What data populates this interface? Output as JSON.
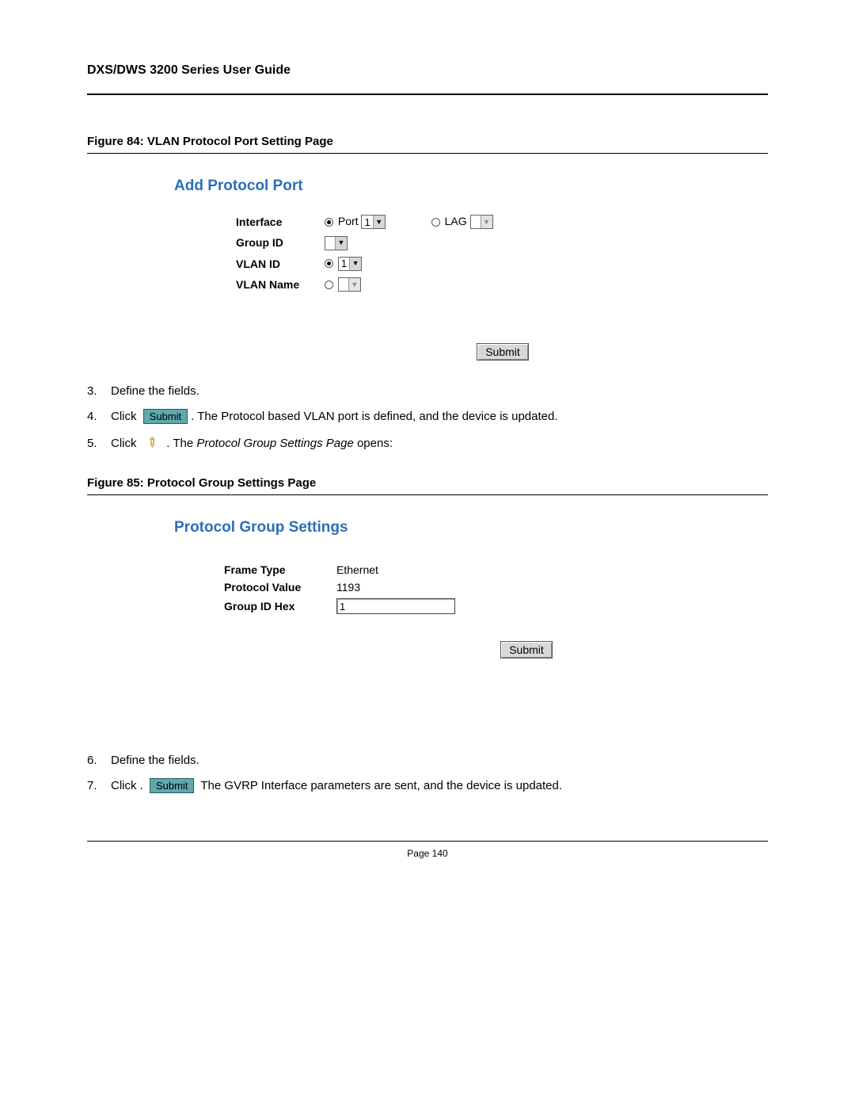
{
  "header": {
    "title": "DXS/DWS 3200 Series User Guide"
  },
  "figure84": {
    "caption": "Figure 84:  VLAN Protocol Port Setting Page",
    "panel_title": "Add Protocol Port",
    "fields": {
      "interface_label": "Interface",
      "port_label": "Port",
      "port_value": "1",
      "lag_label": "LAG",
      "group_id_label": "Group ID",
      "vlan_id_label": "VLAN ID",
      "vlan_id_value": "1",
      "vlan_name_label": "VLAN Name"
    },
    "submit_label": "Submit"
  },
  "steps_a": {
    "s3": {
      "num": "3.",
      "text": "Define the fields."
    },
    "s4": {
      "num": "4.",
      "pre": "Click",
      "btn": "Submit",
      "post": ". The Protocol based VLAN port is defined, and the device is updated."
    },
    "s5": {
      "num": "5.",
      "pre": "Click",
      "post_a": ". The ",
      "post_i": "Protocol Group Settings Page",
      "post_b": " opens:"
    }
  },
  "figure85": {
    "caption": "Figure 85:  Protocol Group Settings Page",
    "panel_title": "Protocol Group Settings",
    "fields": {
      "frame_type_label": "Frame Type",
      "frame_type_value": "Ethernet",
      "protocol_value_label": "Protocol Value",
      "protocol_value_value": "1193",
      "group_id_label": "Group ID  Hex",
      "group_id_value": "1"
    },
    "submit_label": "Submit"
  },
  "steps_b": {
    "s6": {
      "num": "6.",
      "text": "Define the fields."
    },
    "s7": {
      "num": "7.",
      "pre": "Click .",
      "btn": "Submit",
      "post": " The GVRP Interface parameters are sent, and the device is updated."
    }
  },
  "footer": {
    "page": "Page 140"
  }
}
